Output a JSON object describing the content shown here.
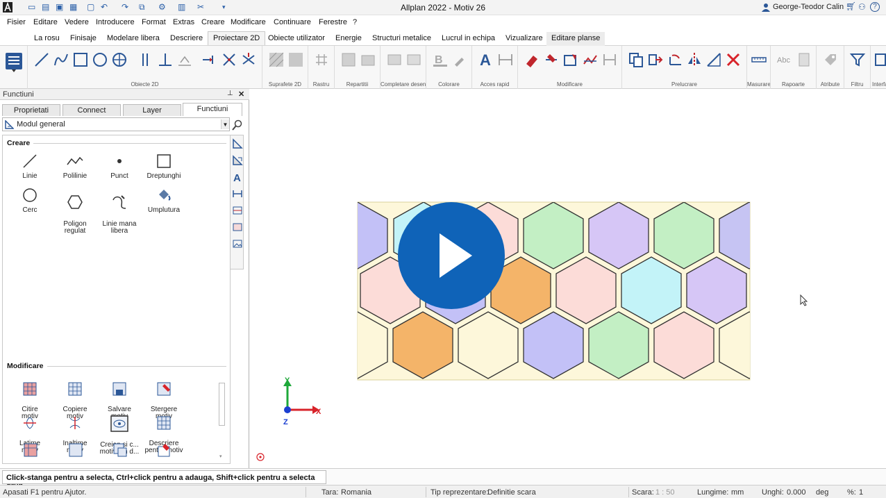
{
  "titlebar": {
    "title": "Allplan 2022 - Motiv 26",
    "user": "George-Teodor Calin",
    "help": "?"
  },
  "menu": [
    "Fisier",
    "Editare",
    "Vedere",
    "Introducere",
    "Format",
    "Extras",
    "Creare",
    "Modificare",
    "Continuare",
    "Ferestre",
    "?"
  ],
  "ribbon_tabs": [
    "La rosu",
    "Finisaje",
    "Modelare libera",
    "Descriere",
    "Proiectare 2D",
    "Obiecte utilizator",
    "Energie",
    "Structuri metalice",
    "Lucrul in echipa",
    "Vizualizare",
    "Editare planse"
  ],
  "active_ribbon_tab": "Proiectare 2D",
  "ribbon_groups": [
    "Obiecte 2D",
    "Suprafete 2D",
    "Rastru",
    "Repartitii",
    "Completare desen",
    "Colorare",
    "Acces rapid",
    "Modificare",
    "Prelucrare",
    "Masurare",
    "Rapoarte",
    "Atribute",
    "Filtru",
    "Interfata"
  ],
  "panel": {
    "title": "Functiuni",
    "pin": "⌂",
    "close": "✕",
    "tabs": [
      "Proprietati",
      "Connect",
      "Layer",
      "Functiuni"
    ],
    "active_tab": "Functiuni",
    "module": "Modul general",
    "section_create": "Creare",
    "create_items": [
      "Linie",
      "Polilinie",
      "Punct",
      "Dreptunghi",
      "Cerc",
      "Poligon\nregulat",
      "Linie mana\nlibera",
      "Umplutura"
    ],
    "section_modify": "Modificare",
    "modify_items": [
      "Citire\nmotiv",
      "Copiere\nmotiv",
      "Salvare\nmotiv",
      "Stergere\nmotiv",
      "Latime\nmotiv",
      "Inaltime\nmotiv",
      "Creion si c...\nmotiv din d...",
      "Descriere\npentru motiv"
    ]
  },
  "canvas": {
    "axis_x": "X",
    "axis_y": "Y",
    "axis_z": "Z",
    "colors": {
      "purple": "#c3c1f7",
      "cyan": "#c3f3f8",
      "pink": "#fcdcd8",
      "green": "#c3efc4",
      "lilac": "#d6c6f6",
      "orange": "#f4b469",
      "cream": "#fdf7da",
      "lavender": "#c6c4f3"
    },
    "play_color": "#0f63b8"
  },
  "status": {
    "hint": "Click-stanga pentru a selecta, Ctrl+click pentru a adauga, Shift+click pentru a selecta grup",
    "help": "Apasati F1 pentru Ajutor.",
    "country_label": "Tara:",
    "country": "Romania",
    "repr_label": "Tip reprezentare:",
    "repr": "Definitie scara",
    "scale_label": "Scara:",
    "scale": "1 : 50",
    "length_label": "Lungime:",
    "length_unit": "mm",
    "angle_label": "Unghi:",
    "angle": "0.000",
    "angle_unit": "deg",
    "percent_label": "%:",
    "percent": "1"
  }
}
